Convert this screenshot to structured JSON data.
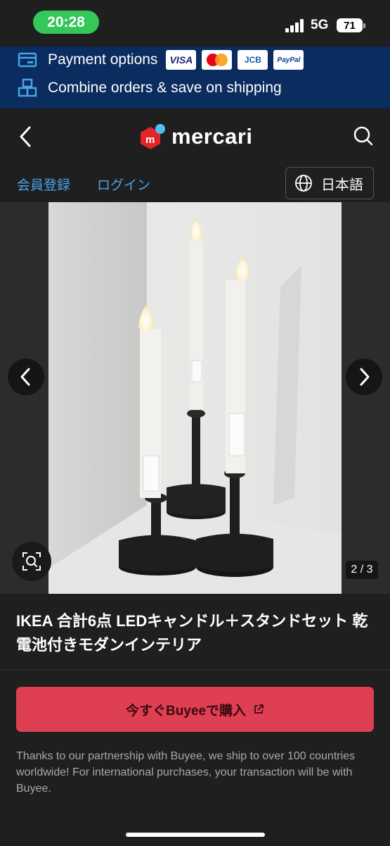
{
  "status_bar": {
    "time": "20:28",
    "network": "5G",
    "battery": "71"
  },
  "promo": {
    "payment_label": "Payment options",
    "payment_methods": [
      "VISA",
      "mastercard",
      "JCB",
      "PayPal"
    ],
    "shipping_label": "Combine orders & save on shipping"
  },
  "header": {
    "logo_text": "mercari"
  },
  "subnav": {
    "register": "会員登録",
    "login": "ログイン",
    "language": "日本語"
  },
  "gallery": {
    "counter": "2 / 3"
  },
  "item": {
    "title": "IKEA 合計6点 LEDキャンドル＋スタンドセット 乾電池付きモダンインテリア"
  },
  "buy": {
    "label": "今すぐBuyeeで購入",
    "note": "Thanks to our partnership with Buyee, we ship to over 100 countries worldwide! For international purchases, your transaction will be with Buyee."
  },
  "colors": {
    "accent": "#df3f52",
    "link": "#4aa3e8",
    "banner": "#0a2c5e",
    "time_pill": "#34c759"
  },
  "icons": [
    "payment-card-icon",
    "boxes-icon",
    "back-icon",
    "mercari-logo-icon",
    "search-icon",
    "globe-icon",
    "chevron-left-icon",
    "chevron-right-icon",
    "zoom-search-icon",
    "external-link-icon"
  ]
}
